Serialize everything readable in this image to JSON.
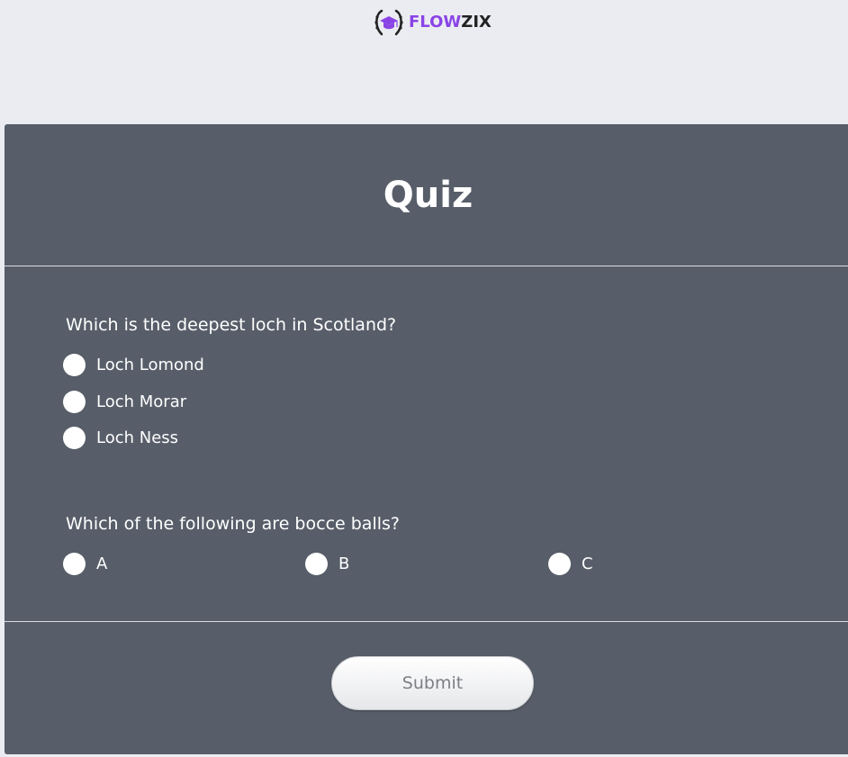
{
  "brand": {
    "logo_part1": "FLOW",
    "logo_part2": "ZIX",
    "logo_icon": "graduation-cap-laurel-icon",
    "accent_color": "#8a44e6"
  },
  "quiz": {
    "title": "Quiz",
    "questions": [
      {
        "text": "Which is the deepest loch in Scotland?",
        "options": [
          "Loch Lomond",
          "Loch Morar",
          "Loch Ness"
        ]
      },
      {
        "text": "Which of the following are bocce balls?",
        "options": [
          "A",
          "B",
          "C"
        ]
      }
    ],
    "submit_label": "Submit"
  },
  "colors": {
    "page_background": "#ebecf1",
    "panel_background": "#575e69",
    "text": "#ffffff"
  }
}
